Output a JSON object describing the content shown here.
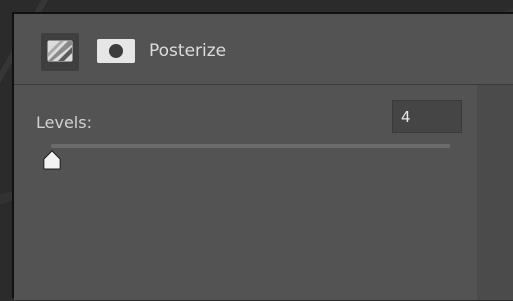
{
  "panel": {
    "title": "Posterize",
    "type_icon": "adjustment-layer-posterize-icon",
    "mask_icon": "layer-mask-icon"
  },
  "levels": {
    "label": "Levels:",
    "value": "4",
    "slider_fraction": 0.0
  },
  "colors": {
    "panel_bg": "#535353",
    "text": "#dcdcdc",
    "input_bg": "#454545",
    "thumb": "#f2f2f2"
  }
}
